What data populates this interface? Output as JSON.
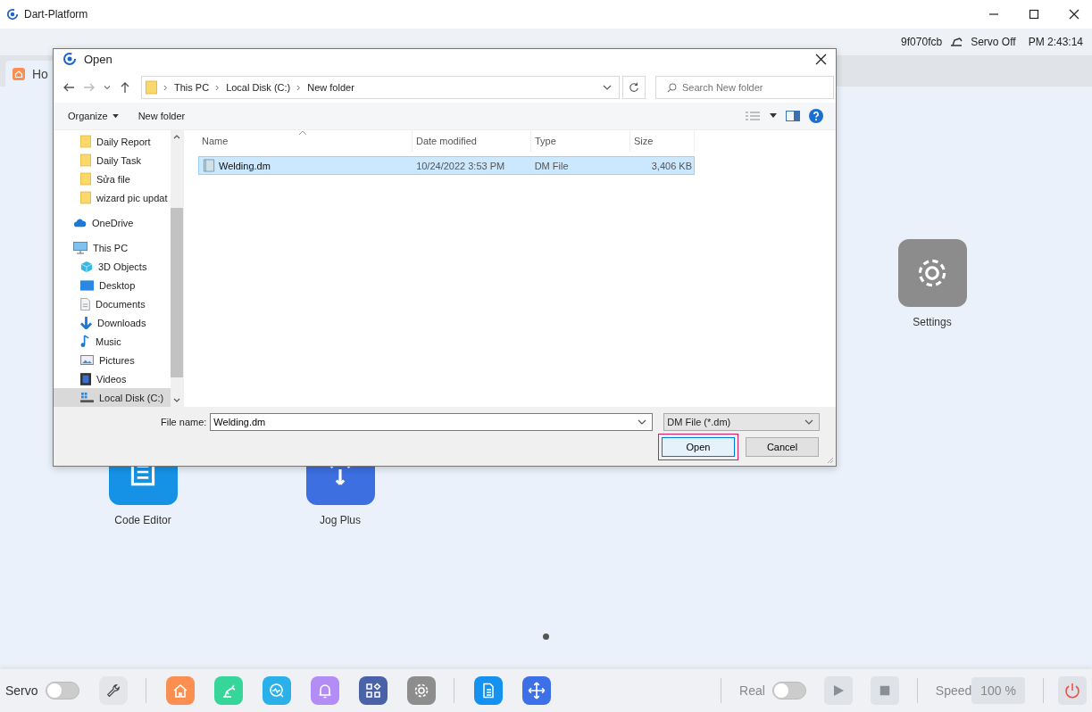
{
  "app": {
    "title": "Dart-Platform"
  },
  "status": {
    "device": "9f070fcb",
    "servo": "Servo Off",
    "time": "PM 2:43:14"
  },
  "tabs": [
    {
      "label": "Ho",
      "selected": true
    }
  ],
  "tiles": [
    {
      "label": "Settings",
      "kind": "gear",
      "color": "#8c8c8c"
    },
    {
      "label": "Code Editor",
      "kind": "document",
      "color": "#1592e6"
    },
    {
      "label": "Jog Plus",
      "kind": "jog",
      "color": "#3d6fe0"
    }
  ],
  "dialog": {
    "title": "Open",
    "breadcrumb": [
      "This PC",
      "Local Disk (C:)",
      "New folder"
    ],
    "search": {
      "placeholder": "Search New folder"
    },
    "toolbar": [
      "Organize",
      "New folder"
    ],
    "nav": [
      {
        "label": "Daily Report",
        "kind": "folder",
        "selected": false
      },
      {
        "label": "Daily Task",
        "kind": "folder",
        "selected": false
      },
      {
        "label": "Sửa file",
        "kind": "folder",
        "selected": false
      },
      {
        "label": "wizard pic updat",
        "kind": "folder",
        "selected": false
      },
      {
        "label": "OneDrive",
        "kind": "cloud",
        "selected": false
      },
      {
        "label": "This PC",
        "kind": "pc",
        "selected": false,
        "children": [
          {
            "label": "3D Objects",
            "kind": "cube",
            "selected": false
          },
          {
            "label": "Desktop",
            "kind": "desktop",
            "selected": false
          },
          {
            "label": "Documents",
            "kind": "documents",
            "selected": false
          },
          {
            "label": "Downloads",
            "kind": "downloads",
            "selected": false
          },
          {
            "label": "Music",
            "kind": "music",
            "selected": false
          },
          {
            "label": "Pictures",
            "kind": "pictures",
            "selected": false
          },
          {
            "label": "Videos",
            "kind": "videos",
            "selected": false
          },
          {
            "label": "Local Disk (C:)",
            "kind": "disk",
            "selected": true
          }
        ]
      }
    ],
    "columns": [
      "Name",
      "Date modified",
      "Type",
      "Size"
    ],
    "rows": [
      {
        "cells": [
          "Welding.dm",
          "10/24/2022 3:53 PM",
          "DM File",
          "3,406 KB"
        ],
        "selected": true
      }
    ],
    "file_name_label": "File name:",
    "file_name": "Welding.dm",
    "file_type": "DM File (*.dm)",
    "buttons": [
      {
        "label": "Open",
        "highlighted": true
      },
      {
        "label": "Cancel",
        "highlighted": false
      }
    ]
  },
  "bottom": {
    "servo_label": "Servo",
    "servo_on": false,
    "dock": [
      {
        "kind": "wrench",
        "color": "#e3e5e8"
      },
      {
        "kind": "home",
        "color": "#fb8f52"
      },
      {
        "kind": "robot",
        "color": "#36d69a"
      },
      {
        "kind": "monitor",
        "color": "#2bb0ea"
      },
      {
        "kind": "bell",
        "color": "#b48cf6"
      },
      {
        "kind": "apps",
        "color": "#4a62a8"
      },
      {
        "kind": "gear",
        "color": "#8d8d8d"
      },
      {
        "kind": "document",
        "color": "#1592f0"
      },
      {
        "kind": "move",
        "color": "#3d6fe6"
      }
    ],
    "real_label": "Real",
    "real_on": false,
    "speed_label": "Speed",
    "speed": "100 %"
  }
}
